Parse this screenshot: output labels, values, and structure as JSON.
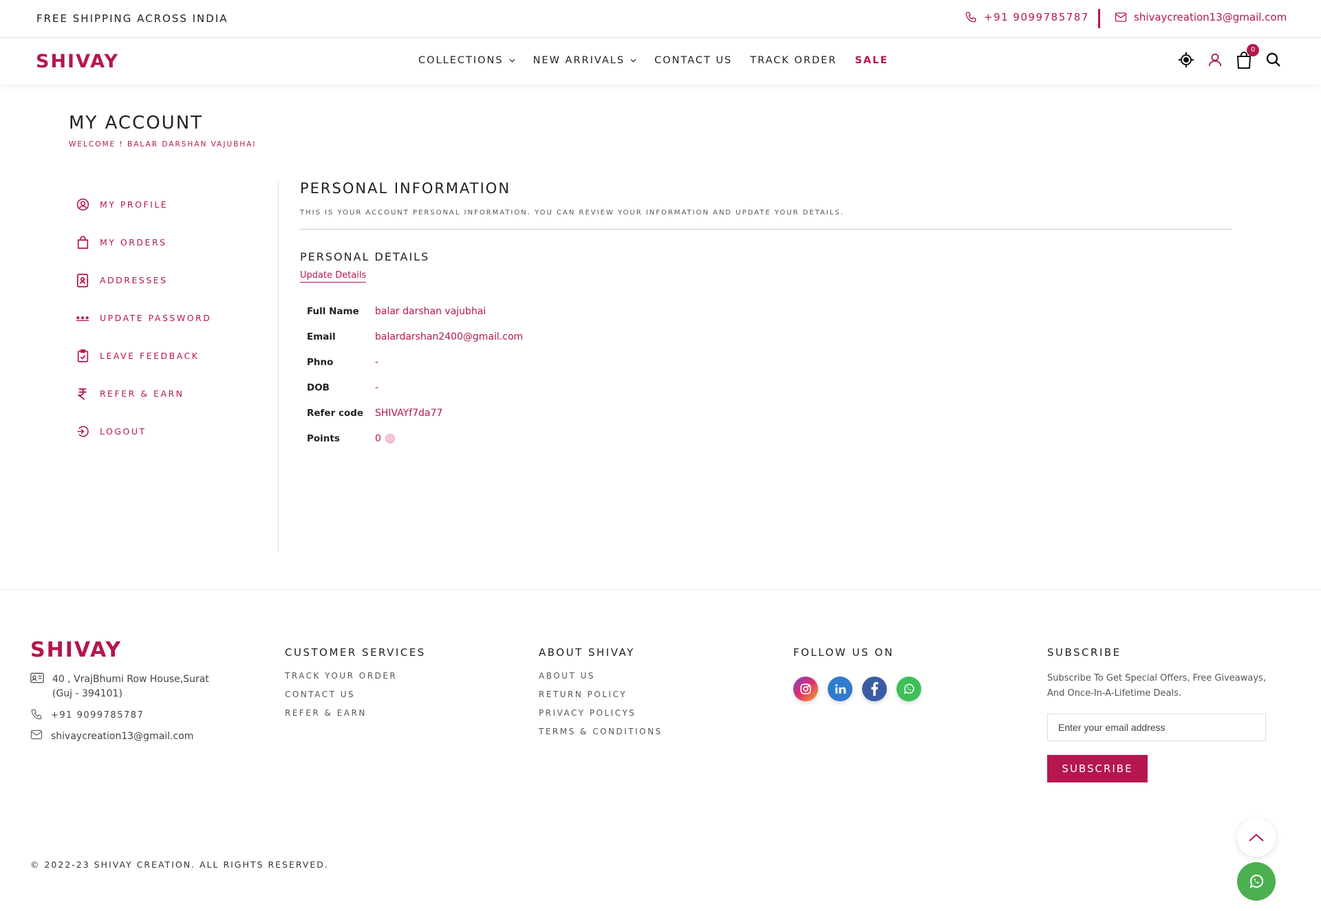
{
  "topbar": {
    "shipping": "FREE SHIPPING ACROSS INDIA",
    "phone": "+91 9099785787",
    "email": "shivaycreation13@gmail.com"
  },
  "nav": {
    "logo": "SHIVAY",
    "items": [
      "COLLECTIONS",
      "NEW ARRIVALS",
      "CONTACT US",
      "TRACK ORDER",
      "SALE"
    ],
    "cart_count": "0"
  },
  "account": {
    "title": "MY ACCOUNT",
    "welcome": "WELCOME ! BALAR DARSHAN VAJUBHAI"
  },
  "sidebar": {
    "items": [
      "MY PROFILE",
      "MY ORDERS",
      "ADDRESSES",
      "UPDATE PASSWORD",
      "LEAVE FEEDBACK",
      "REFER & EARN",
      "LOGOUT"
    ]
  },
  "personal": {
    "title": "PERSONAL INFORMATION",
    "subtitle": "THIS IS YOUR ACCOUNT PERSONAL INFORMATION. YOU CAN REVIEW YOUR INFORMATION AND UPDATE YOUR DETAILS.",
    "details_title": "PERSONAL DETAILS",
    "update_link": "Update Details",
    "rows": [
      {
        "label": "Full Name",
        "value": "balar darshan vajubhai"
      },
      {
        "label": "Email",
        "value": "balardarshan2400@gmail.com"
      },
      {
        "label": "Phno",
        "value": "-"
      },
      {
        "label": "DOB",
        "value": "-"
      },
      {
        "label": "Refer code",
        "value": "SHIVAYf7da77"
      },
      {
        "label": "Points",
        "value": "0"
      }
    ]
  },
  "footer": {
    "logo": "SHIVAY",
    "address_line1": "40 , VrajBhumi Row House,Surat",
    "address_line2": "(Guj - 394101)",
    "phone": "+91 9099785787",
    "email": "shivaycreation13@gmail.com",
    "customer_services": {
      "heading": "CUSTOMER SERVICES",
      "links": [
        "TRACK YOUR ORDER",
        "CONTACT US",
        "REFER & EARN"
      ]
    },
    "about": {
      "heading": "ABOUT SHIVAY",
      "links": [
        "ABOUT US",
        "RETURN POLICY",
        "PRIVACY POLICYS",
        "TERMS & CONDITIONS"
      ]
    },
    "follow": {
      "heading": "FOLLOW US ON",
      "icons": [
        "instagram-icon",
        "linkedin-icon",
        "facebook-icon",
        "whatsapp-icon"
      ]
    },
    "subscribe": {
      "heading": "SUBSCRIBE",
      "text": "Subscribe To Get Special Offers, Free Giveaways, And Once-In-A-Lifetime Deals.",
      "placeholder": "Enter your email address",
      "button": "SUBSCRIBE"
    },
    "copyright": "© 2022-23 SHIVAY CREATION. ALL RIGHTS RESERVED."
  },
  "colors": {
    "brand": "#b5164f",
    "whatsapp": "#4caf50"
  }
}
